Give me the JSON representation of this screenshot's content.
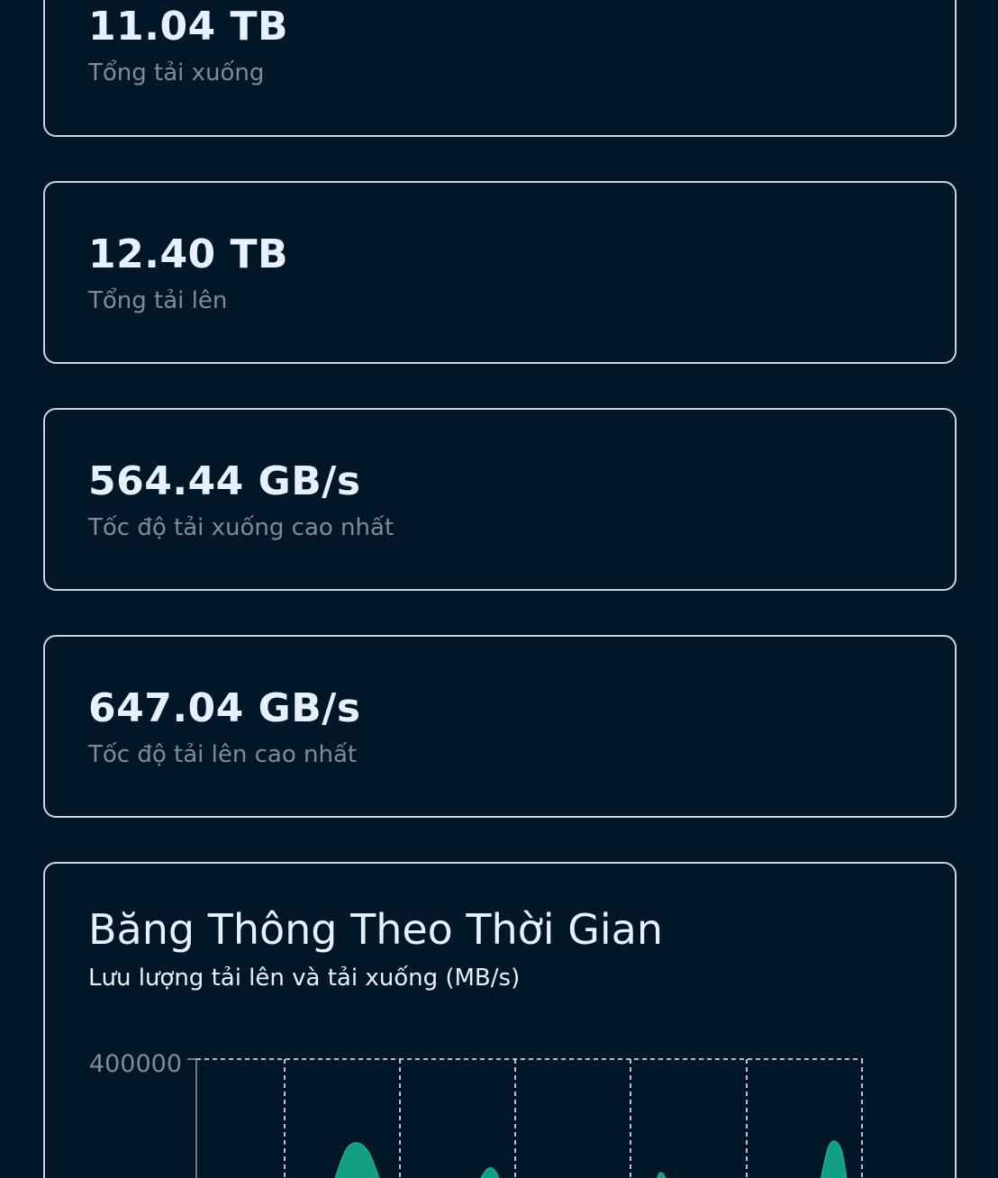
{
  "stats": [
    {
      "value": "11.04 TB",
      "label": "Tổng tải xuống"
    },
    {
      "value": "12.40 TB",
      "label": "Tổng tải lên"
    },
    {
      "value": "564.44 GB/s",
      "label": "Tốc độ tải xuống cao nhất"
    },
    {
      "value": "647.04 GB/s",
      "label": "Tốc độ tải lên cao nhất"
    }
  ],
  "chart_card": {
    "title": "Băng Thông Theo Thời Gian",
    "subtitle": "Lưu lượng tải lên và tải xuống (MB/s)"
  },
  "chart_data": {
    "type": "area",
    "title": "Băng Thông Theo Thời Gian",
    "subtitle": "Lưu lượng tải lên và tải xuống (MB/s)",
    "y_ticks": [
      "400000"
    ],
    "ylim": [
      0,
      400000
    ],
    "grid": true,
    "series": [
      {
        "color": "#14a085"
      }
    ]
  }
}
